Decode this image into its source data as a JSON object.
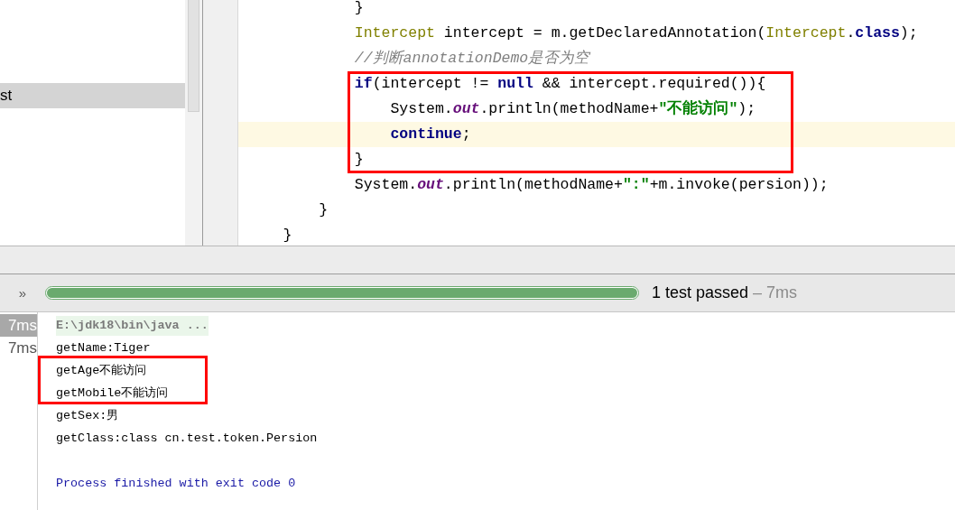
{
  "project_tree": {
    "items": [
      {
        "label": "st",
        "selected": true
      }
    ]
  },
  "editor": {
    "blocks": [
      {
        "framed": false,
        "lines": [
          {
            "current": false,
            "tokens": [
              {
                "kind": "plain",
                "text": "            }"
              }
            ]
          },
          {
            "current": false,
            "tokens": [
              {
                "kind": "type",
                "text": "            Intercept"
              },
              {
                "kind": "plain",
                "text": " intercept = m.getDeclaredAnnotation("
              },
              {
                "kind": "type",
                "text": "Intercept"
              },
              {
                "kind": "plain",
                "text": "."
              },
              {
                "kind": "keyword",
                "text": "class"
              },
              {
                "kind": "plain",
                "text": ");"
              }
            ]
          },
          {
            "current": false,
            "tokens": [
              {
                "kind": "comment",
                "text": "            //判断annotationDemo是否为空"
              }
            ]
          }
        ]
      },
      {
        "framed": true,
        "lines": [
          {
            "current": false,
            "tokens": [
              {
                "kind": "keyword",
                "text": "            if"
              },
              {
                "kind": "plain",
                "text": "(intercept != "
              },
              {
                "kind": "keyword",
                "text": "null"
              },
              {
                "kind": "plain",
                "text": " && intercept.required()){"
              }
            ]
          },
          {
            "current": false,
            "tokens": [
              {
                "kind": "plain",
                "text": "                System."
              },
              {
                "kind": "field",
                "text": "out"
              },
              {
                "kind": "plain",
                "text": ".println(methodName+"
              },
              {
                "kind": "string",
                "text": "\"不能访问\""
              },
              {
                "kind": "plain",
                "text": ");"
              }
            ]
          },
          {
            "current": true,
            "tokens": [
              {
                "kind": "keyword",
                "text": "                continue"
              },
              {
                "kind": "plain",
                "text": ";"
              }
            ]
          },
          {
            "current": false,
            "tokens": [
              {
                "kind": "plain",
                "text": "            }"
              }
            ]
          }
        ]
      },
      {
        "framed": false,
        "lines": [
          {
            "current": false,
            "tokens": [
              {
                "kind": "plain",
                "text": "            System."
              },
              {
                "kind": "field",
                "text": "out"
              },
              {
                "kind": "plain",
                "text": ".println(methodName+"
              },
              {
                "kind": "string",
                "text": "\":\""
              },
              {
                "kind": "plain",
                "text": "+m.invoke(persion));"
              }
            ]
          },
          {
            "current": false,
            "tokens": [
              {
                "kind": "plain",
                "text": "        }"
              }
            ]
          },
          {
            "current": false,
            "tokens": [
              {
                "kind": "plain",
                "text": "    }"
              }
            ]
          }
        ]
      }
    ]
  },
  "test_runner": {
    "expand_glyph": "»",
    "progress": {
      "level": 1.0
    },
    "status": "1 test passed",
    "duration": "– 7ms",
    "times": [
      {
        "label": "7ms",
        "selected": true
      },
      {
        "label": "7ms",
        "selected": false
      }
    ]
  },
  "console": {
    "blocks": [
      {
        "framed": false,
        "lines": [
          {
            "kind": "command",
            "text": "E:\\jdk18\\bin\\java ..."
          },
          {
            "kind": "output",
            "text": "getName:Tiger"
          }
        ]
      },
      {
        "framed": true,
        "lines": [
          {
            "kind": "output",
            "text": "getAge不能访问"
          },
          {
            "kind": "output",
            "text": "getMobile不能访问"
          }
        ]
      },
      {
        "framed": false,
        "lines": [
          {
            "kind": "output",
            "text": "getSex:男"
          },
          {
            "kind": "output",
            "text": "getClass:class cn.test.token.Persion"
          },
          {
            "kind": "blank"
          },
          {
            "kind": "process",
            "text": "Process finished with exit code 0"
          }
        ]
      }
    ]
  }
}
